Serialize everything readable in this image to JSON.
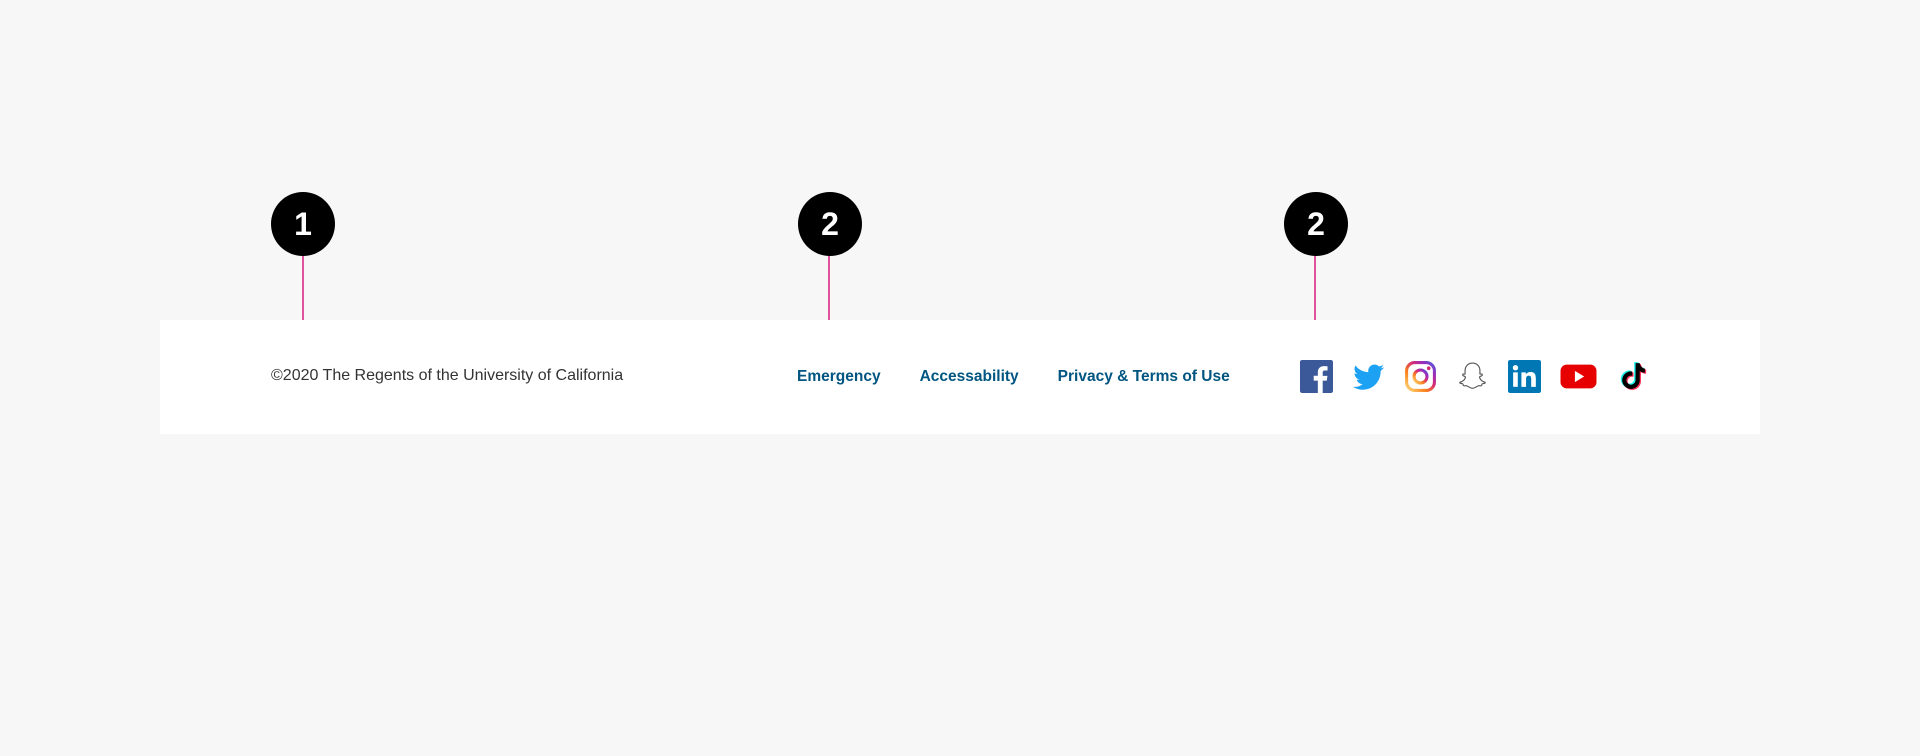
{
  "markers": [
    {
      "number": "1"
    },
    {
      "number": "2"
    },
    {
      "number": "2"
    }
  ],
  "footer": {
    "copyright": "©2020 The Regents of the University of California",
    "links": [
      {
        "label": "Emergency"
      },
      {
        "label": "Accessability"
      },
      {
        "label": "Privacy & Terms of Use"
      }
    ],
    "link_color": "#005581",
    "social_icons": [
      {
        "name": "facebook-icon",
        "color": "#3b5998"
      },
      {
        "name": "twitter-icon",
        "color": "#1da1f2"
      },
      {
        "name": "instagram-icon",
        "color": "#c13584"
      },
      {
        "name": "snapchat-icon",
        "color": "#555555"
      },
      {
        "name": "linkedin-icon",
        "color": "#0077b5"
      },
      {
        "name": "youtube-icon",
        "color": "#e60000"
      },
      {
        "name": "tiktok-icon",
        "color": "#000000"
      }
    ]
  },
  "annotation_line_color": "#e0529c"
}
